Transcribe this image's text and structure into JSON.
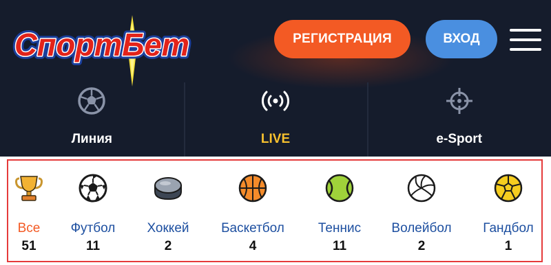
{
  "header": {
    "logo_text": "СпортБет",
    "register_label": "РЕГИСТРАЦИЯ",
    "login_label": "ВХОД"
  },
  "nav_tabs": [
    {
      "label": "Линия",
      "icon": "soccer-ball-icon"
    },
    {
      "label": "LIVE",
      "icon": "broadcast-icon",
      "active": true
    },
    {
      "label": "e-Sport",
      "icon": "crosshair-icon"
    }
  ],
  "sports": [
    {
      "name": "Все",
      "count": "51",
      "icon": "trophy-icon",
      "active": true
    },
    {
      "name": "Футбол",
      "count": "11",
      "icon": "soccer-ball-icon"
    },
    {
      "name": "Хоккей",
      "count": "2",
      "icon": "hockey-puck-icon"
    },
    {
      "name": "Баскетбол",
      "count": "4",
      "icon": "basketball-icon"
    },
    {
      "name": "Теннис",
      "count": "11",
      "icon": "tennis-ball-icon"
    },
    {
      "name": "Волейбол",
      "count": "2",
      "icon": "volleyball-icon"
    },
    {
      "name": "Гандбол",
      "count": "1",
      "icon": "handball-icon"
    }
  ],
  "colors": {
    "header_bg": "#151c2c",
    "accent_orange": "#f35a24",
    "accent_blue": "#4a8fe0",
    "live_yellow": "#f7c12e",
    "sport_label_blue": "#1d4fa0",
    "frame_red": "#e53a3a"
  }
}
